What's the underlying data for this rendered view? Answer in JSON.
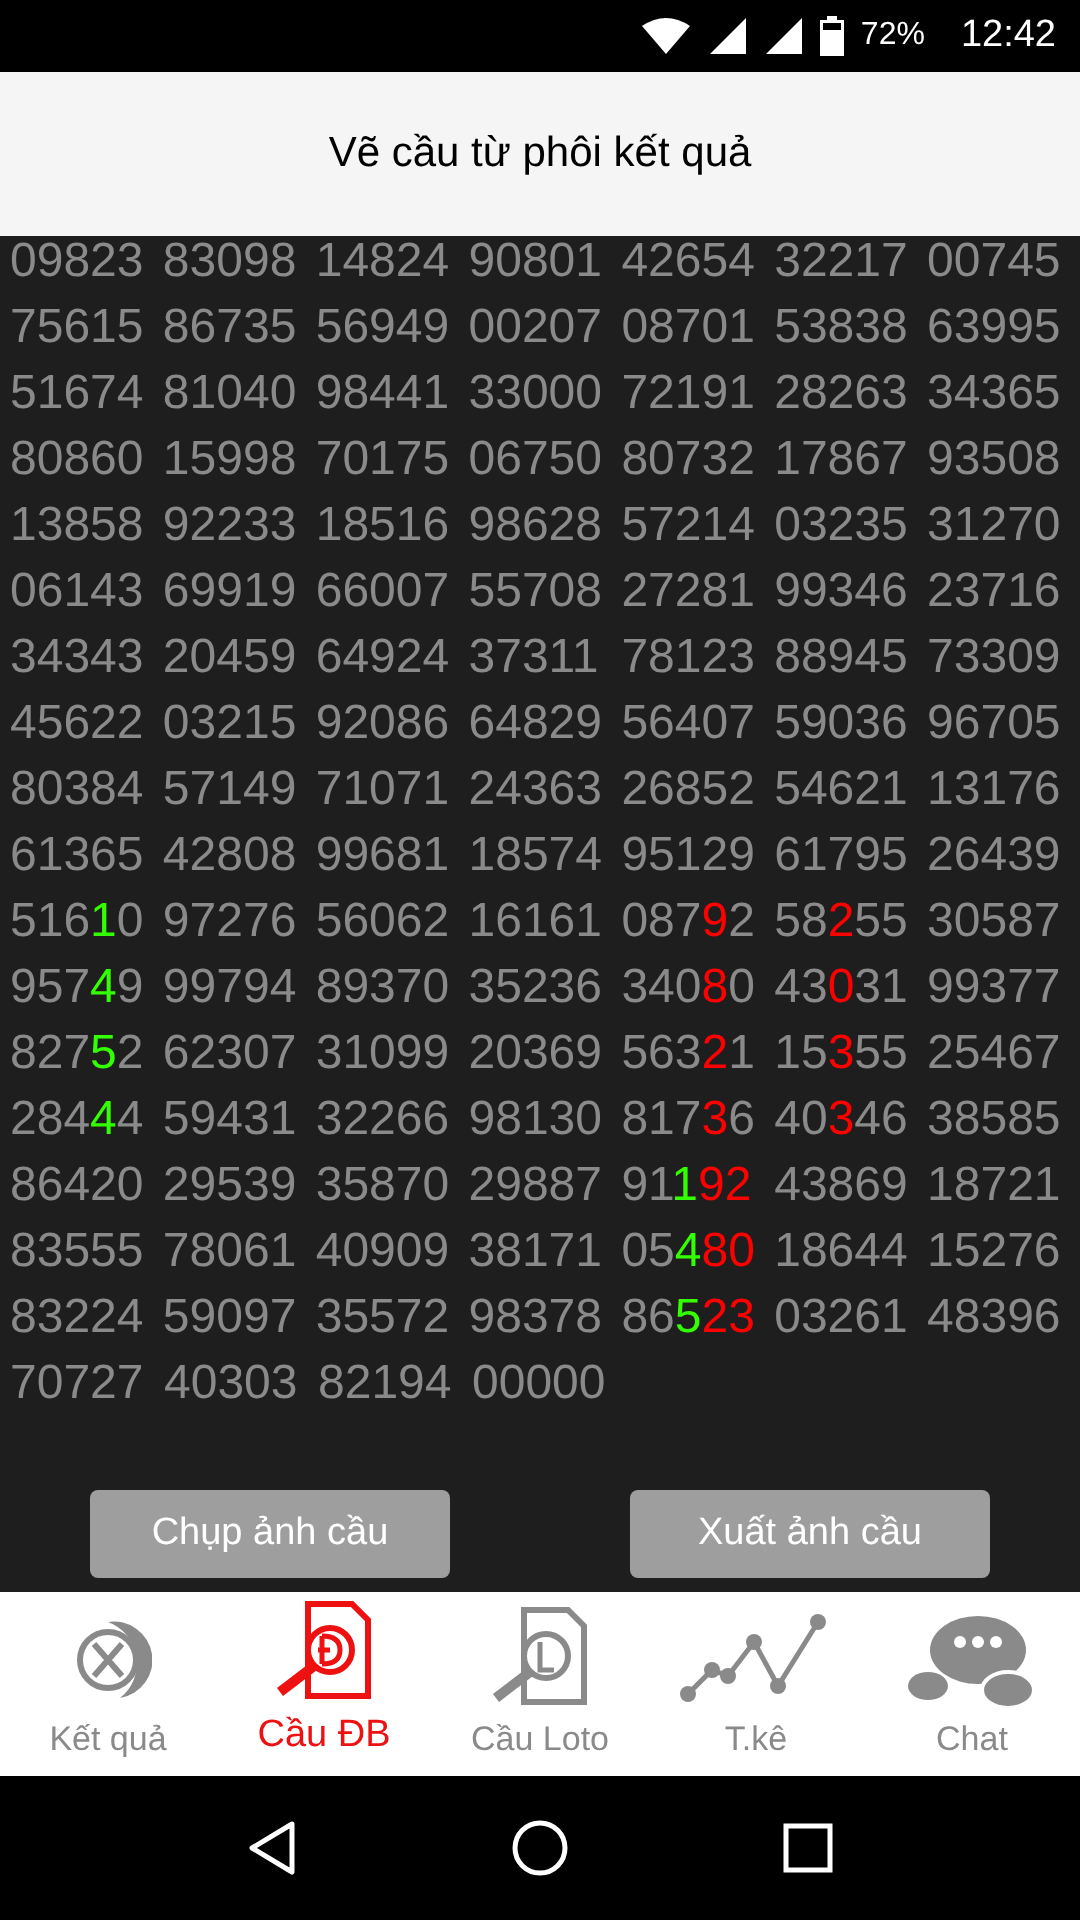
{
  "status_bar": {
    "battery": "72%",
    "time": "12:42"
  },
  "header": {
    "title": "Vẽ cầu từ phôi kết quả"
  },
  "grid": {
    "rows": [
      [
        [
          {
            "text": "09823"
          }
        ],
        [
          {
            "text": "83098"
          }
        ],
        [
          {
            "text": "14824"
          }
        ],
        [
          {
            "text": "90801"
          }
        ],
        [
          {
            "text": "42654"
          }
        ],
        [
          {
            "text": "32217"
          }
        ],
        [
          {
            "text": "00745"
          }
        ]
      ],
      [
        [
          {
            "text": "75615"
          }
        ],
        [
          {
            "text": "86735"
          }
        ],
        [
          {
            "text": "56949"
          }
        ],
        [
          {
            "text": "00207"
          }
        ],
        [
          {
            "text": "08701"
          }
        ],
        [
          {
            "text": "53838"
          }
        ],
        [
          {
            "text": "63995"
          }
        ]
      ],
      [
        [
          {
            "text": "51674"
          }
        ],
        [
          {
            "text": "81040"
          }
        ],
        [
          {
            "text": "98441"
          }
        ],
        [
          {
            "text": "33000"
          }
        ],
        [
          {
            "text": "72191"
          }
        ],
        [
          {
            "text": "28263"
          }
        ],
        [
          {
            "text": "34365"
          }
        ]
      ],
      [
        [
          {
            "text": "80860"
          }
        ],
        [
          {
            "text": "15998"
          }
        ],
        [
          {
            "text": "70175"
          }
        ],
        [
          {
            "text": "06750"
          }
        ],
        [
          {
            "text": "80732"
          }
        ],
        [
          {
            "text": "17867"
          }
        ],
        [
          {
            "text": "93508"
          }
        ]
      ],
      [
        [
          {
            "text": "13858"
          }
        ],
        [
          {
            "text": "92233"
          }
        ],
        [
          {
            "text": "18516"
          }
        ],
        [
          {
            "text": "98628"
          }
        ],
        [
          {
            "text": "57214"
          }
        ],
        [
          {
            "text": "03235"
          }
        ],
        [
          {
            "text": "31270"
          }
        ]
      ],
      [
        [
          {
            "text": "06143"
          }
        ],
        [
          {
            "text": "69919"
          }
        ],
        [
          {
            "text": "66007"
          }
        ],
        [
          {
            "text": "55708"
          }
        ],
        [
          {
            "text": "27281"
          }
        ],
        [
          {
            "text": "99346"
          }
        ],
        [
          {
            "text": "23716"
          }
        ]
      ],
      [
        [
          {
            "text": "34343"
          }
        ],
        [
          {
            "text": "20459"
          }
        ],
        [
          {
            "text": "64924"
          }
        ],
        [
          {
            "text": "37311"
          }
        ],
        [
          {
            "text": "78123"
          }
        ],
        [
          {
            "text": "88945"
          }
        ],
        [
          {
            "text": "73309"
          }
        ]
      ],
      [
        [
          {
            "text": "45622"
          }
        ],
        [
          {
            "text": "03215"
          }
        ],
        [
          {
            "text": "92086"
          }
        ],
        [
          {
            "text": "64829"
          }
        ],
        [
          {
            "text": "56407"
          }
        ],
        [
          {
            "text": "59036"
          }
        ],
        [
          {
            "text": "96705"
          }
        ]
      ],
      [
        [
          {
            "text": "80384"
          }
        ],
        [
          {
            "text": "57149"
          }
        ],
        [
          {
            "text": "71071"
          }
        ],
        [
          {
            "text": "24363"
          }
        ],
        [
          {
            "text": "26852"
          }
        ],
        [
          {
            "text": "54621"
          }
        ],
        [
          {
            "text": "13176"
          }
        ]
      ],
      [
        [
          {
            "text": "61365"
          }
        ],
        [
          {
            "text": "42808"
          }
        ],
        [
          {
            "text": "99681"
          }
        ],
        [
          {
            "text": "18574"
          }
        ],
        [
          {
            "text": "95129"
          }
        ],
        [
          {
            "text": "61795"
          }
        ],
        [
          {
            "text": "26439"
          }
        ]
      ],
      [
        [
          {
            "text": "516"
          },
          {
            "text": "1",
            "color": "#33ff00"
          },
          {
            "text": "0"
          }
        ],
        [
          {
            "text": "97276"
          }
        ],
        [
          {
            "text": "56062"
          }
        ],
        [
          {
            "text": "16161"
          }
        ],
        [
          {
            "text": "087"
          },
          {
            "text": "9",
            "color": "#ff0000"
          },
          {
            "text": "2"
          }
        ],
        [
          {
            "text": "58"
          },
          {
            "text": "2",
            "color": "#ff0000"
          },
          {
            "text": "55"
          }
        ],
        [
          {
            "text": "30587"
          }
        ]
      ],
      [
        [
          {
            "text": "957"
          },
          {
            "text": "4",
            "color": "#33ff00"
          },
          {
            "text": "9"
          }
        ],
        [
          {
            "text": "99794"
          }
        ],
        [
          {
            "text": "89370"
          }
        ],
        [
          {
            "text": "35236"
          }
        ],
        [
          {
            "text": "340"
          },
          {
            "text": "8",
            "color": "#ff0000"
          },
          {
            "text": "0"
          }
        ],
        [
          {
            "text": "43"
          },
          {
            "text": "0",
            "color": "#ff0000"
          },
          {
            "text": "31"
          }
        ],
        [
          {
            "text": "99377"
          }
        ]
      ],
      [
        [
          {
            "text": "827"
          },
          {
            "text": "5",
            "color": "#33ff00"
          },
          {
            "text": "2"
          }
        ],
        [
          {
            "text": "62307"
          }
        ],
        [
          {
            "text": "31099"
          }
        ],
        [
          {
            "text": "20369"
          }
        ],
        [
          {
            "text": "563"
          },
          {
            "text": "2",
            "color": "#ff0000"
          },
          {
            "text": "1"
          }
        ],
        [
          {
            "text": "15"
          },
          {
            "text": "3",
            "color": "#ff0000"
          },
          {
            "text": "55"
          }
        ],
        [
          {
            "text": "25467"
          }
        ]
      ],
      [
        [
          {
            "text": "284"
          },
          {
            "text": "4",
            "color": "#33ff00"
          },
          {
            "text": "4"
          }
        ],
        [
          {
            "text": "59431"
          }
        ],
        [
          {
            "text": "32266"
          }
        ],
        [
          {
            "text": "98130"
          }
        ],
        [
          {
            "text": "817"
          },
          {
            "text": "3",
            "color": "#ff0000"
          },
          {
            "text": "6"
          }
        ],
        [
          {
            "text": "40"
          },
          {
            "text": "3",
            "color": "#ff0000"
          },
          {
            "text": "46"
          }
        ],
        [
          {
            "text": "38585"
          }
        ]
      ],
      [
        [
          {
            "text": "86420"
          }
        ],
        [
          {
            "text": "29539"
          }
        ],
        [
          {
            "text": "35870"
          }
        ],
        [
          {
            "text": "29887"
          }
        ],
        [
          {
            "text": "91"
          },
          {
            "text": "1",
            "color": "#33ff00"
          },
          {
            "text": "92",
            "color": "#ff0000"
          }
        ],
        [
          {
            "text": "43869"
          }
        ],
        [
          {
            "text": "18721"
          }
        ]
      ],
      [
        [
          {
            "text": "83555"
          }
        ],
        [
          {
            "text": "78061"
          }
        ],
        [
          {
            "text": "40909"
          }
        ],
        [
          {
            "text": "38171"
          }
        ],
        [
          {
            "text": "05"
          },
          {
            "text": "4",
            "color": "#33ff00"
          },
          {
            "text": "80",
            "color": "#ff0000"
          }
        ],
        [
          {
            "text": "18644"
          }
        ],
        [
          {
            "text": "15276"
          }
        ]
      ],
      [
        [
          {
            "text": "83224"
          }
        ],
        [
          {
            "text": "59097"
          }
        ],
        [
          {
            "text": "35572"
          }
        ],
        [
          {
            "text": "98378"
          }
        ],
        [
          {
            "text": "86"
          },
          {
            "text": "5",
            "color": "#33ff00"
          },
          {
            "text": "23",
            "color": "#ff0000"
          }
        ],
        [
          {
            "text": "03261"
          }
        ],
        [
          {
            "text": "48396"
          }
        ]
      ],
      [
        [
          {
            "text": "70727"
          }
        ],
        [
          {
            "text": "40303"
          }
        ],
        [
          {
            "text": "82194"
          }
        ],
        [
          {
            "text": "00000"
          }
        ]
      ]
    ]
  },
  "buttons": [
    "Chụp ảnh cầu",
    "Xuất ảnh cầu"
  ],
  "bottom_nav": [
    {
      "kind": "results",
      "label": "Kết quả",
      "selected": false
    },
    {
      "kind": "special",
      "label": "Cầu ĐB",
      "selected": true
    },
    {
      "kind": "loto",
      "label": "Cầu Loto",
      "selected": false
    },
    {
      "kind": "stats",
      "label": "T.kê",
      "selected": false
    },
    {
      "kind": "chat",
      "label": "Chat",
      "selected": false
    }
  ]
}
